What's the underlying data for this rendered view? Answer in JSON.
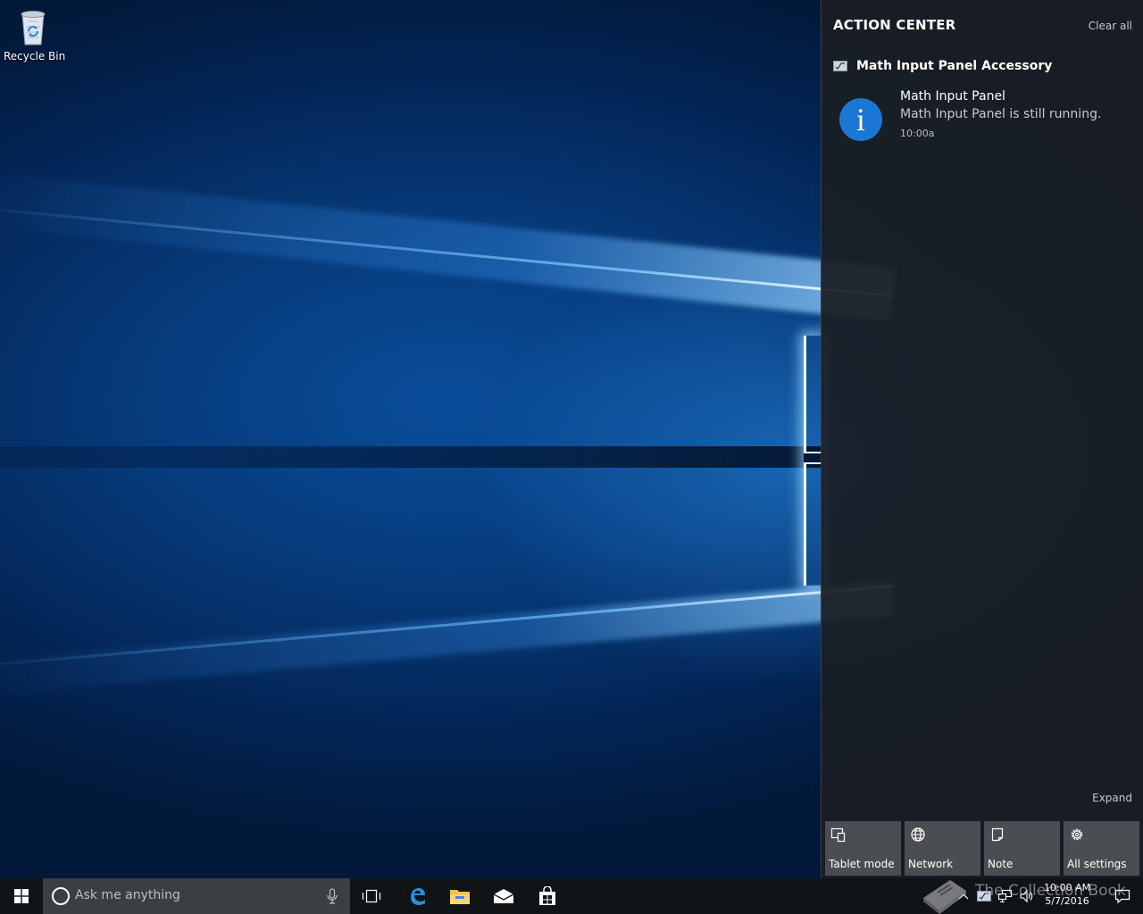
{
  "desktop": {
    "icons": [
      {
        "label": "Recycle Bin",
        "icon": "recycle-bin-icon"
      }
    ]
  },
  "action_center": {
    "title": "ACTION CENTER",
    "clear_all": "Clear all",
    "group": {
      "app_name": "Math Input Panel Accessory",
      "icon": "math-input-icon"
    },
    "notification": {
      "icon": "info-icon",
      "icon_glyph": "i",
      "title": "Math Input Panel",
      "body": "Math Input Panel is still running.",
      "time": "10:00a"
    },
    "expand": "Expand",
    "quick_actions": [
      {
        "label": "Tablet mode",
        "icon": "tablet-mode-icon"
      },
      {
        "label": "Network",
        "icon": "network-icon"
      },
      {
        "label": "Note",
        "icon": "note-icon"
      },
      {
        "label": "All settings",
        "icon": "settings-icon"
      }
    ]
  },
  "taskbar": {
    "search_placeholder": "Ask me anything",
    "pinned": [
      {
        "name": "Task View",
        "icon": "task-view-icon"
      },
      {
        "name": "Microsoft Edge",
        "icon": "edge-icon"
      },
      {
        "name": "File Explorer",
        "icon": "file-explorer-icon"
      },
      {
        "name": "Mail",
        "icon": "mail-icon"
      },
      {
        "name": "Store",
        "icon": "store-icon"
      }
    ],
    "clock": {
      "time": "10:00 AM",
      "date": "5/7/2016"
    }
  },
  "watermark": {
    "text": "The Collection Book"
  },
  "colors": {
    "accent": "#1a78d4",
    "action_center_bg": "#1a1e24",
    "tile_bg": "#4a4d52",
    "taskbar_bg": "#101417",
    "search_bg": "#3b3e42"
  }
}
